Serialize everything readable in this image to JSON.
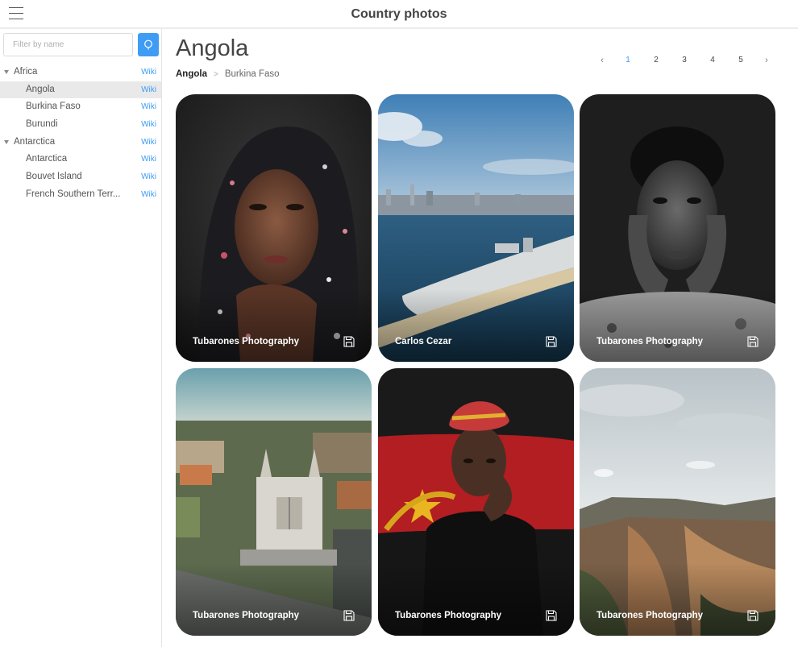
{
  "app": {
    "title": "Country photos",
    "menu_icon": "hamburger-icon"
  },
  "sidebar": {
    "filter_placeholder": "Filter by name",
    "filter_value": "",
    "search_icon": "search-icon",
    "tree": [
      {
        "label": "Africa",
        "wiki": "Wiki",
        "level": 0,
        "expanded": true
      },
      {
        "label": "Angola",
        "wiki": "Wiki",
        "level": 1,
        "selected": true
      },
      {
        "label": "Burkina Faso",
        "wiki": "Wiki",
        "level": 1
      },
      {
        "label": "Burundi",
        "wiki": "Wiki",
        "level": 1
      },
      {
        "label": "Antarctica",
        "wiki": "Wiki",
        "level": 0,
        "expanded": true
      },
      {
        "label": "Antarctica",
        "wiki": "Wiki",
        "level": 1
      },
      {
        "label": "Bouvet Island",
        "wiki": "Wiki",
        "level": 1
      },
      {
        "label": "French Southern Terr...",
        "wiki": "Wiki",
        "level": 1
      }
    ]
  },
  "main": {
    "title": "Angola",
    "breadcrumb": {
      "current": "Angola",
      "next": "Burkina Faso"
    },
    "pagination": {
      "prev": "‹",
      "pages": [
        "1",
        "2",
        "3",
        "4",
        "5"
      ],
      "active": "1",
      "next": "›"
    },
    "photos": [
      {
        "author": "Tubarones Photography",
        "scene": "portrait-headscarf"
      },
      {
        "author": "Carlos Cezar",
        "scene": "city-bay-aerial"
      },
      {
        "author": "Tubarones Photography",
        "scene": "portrait-bw"
      },
      {
        "author": "Tubarones Photography",
        "scene": "cathedral-aerial"
      },
      {
        "author": "Tubarones Photography",
        "scene": "portrait-flag"
      },
      {
        "author": "Tubarones Photography",
        "scene": "cliffs-landscape"
      }
    ]
  },
  "colors": {
    "accent": "#3f9cf5",
    "selected_row": "#e9e9e9",
    "title": "#444444"
  }
}
